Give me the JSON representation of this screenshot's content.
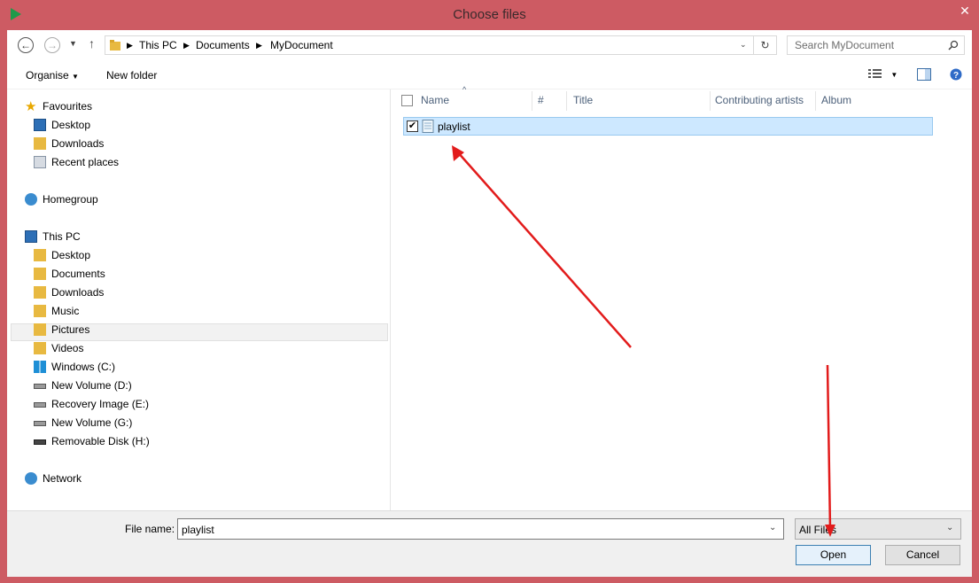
{
  "window": {
    "title": "Choose files"
  },
  "address": {
    "segments": [
      "This PC",
      "Documents",
      "MyDocument"
    ]
  },
  "search": {
    "placeholder": "Search MyDocument"
  },
  "toolbar": {
    "organise": "Organise",
    "new_folder": "New folder"
  },
  "nav": {
    "favourites": {
      "label": "Favourites",
      "items": [
        "Desktop",
        "Downloads",
        "Recent places"
      ]
    },
    "homegroup": "Homegroup",
    "thispc": {
      "label": "This PC",
      "items": [
        "Desktop",
        "Documents",
        "Downloads",
        "Music",
        "Pictures",
        "Videos",
        "Windows (C:)",
        "New Volume (D:)",
        "Recovery Image (E:)",
        "New Volume (G:)",
        "Removable Disk (H:)"
      ]
    },
    "network": "Network",
    "selected": "Documents"
  },
  "columns": [
    "Name",
    "#",
    "Title",
    "Contributing artists",
    "Album"
  ],
  "files": [
    {
      "name": "playlist",
      "checked": true,
      "selected": true
    }
  ],
  "bottom": {
    "file_name_label": "File name:",
    "file_name_value": "playlist",
    "filter": "All Files",
    "open": "Open",
    "cancel": "Cancel"
  },
  "colors": {
    "titlebar": "#cd5b63",
    "selection": "#cde8ff",
    "arrow": "#e21b1b"
  }
}
